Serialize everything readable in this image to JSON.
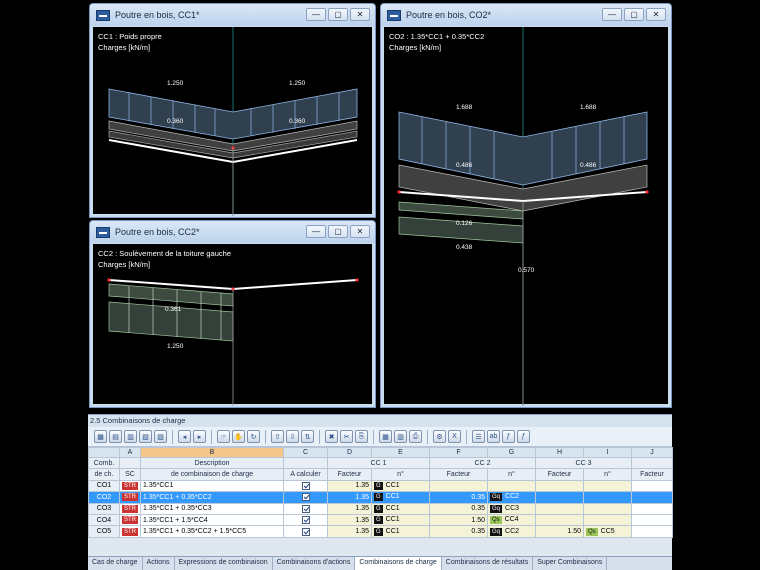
{
  "windows": {
    "cc1": {
      "title": "Poutre en bois, CC1*",
      "info_line1": "CC1 : Poids propre",
      "info_line2": "Charges [kN/m]",
      "labels": [
        "1.250",
        "1.250",
        "0.360",
        "0.360"
      ]
    },
    "cc2": {
      "title": "Poutre en bois, CC2*",
      "info_line1": "CC2 : Soulèvement de la toiture gauche",
      "info_line2": "Charges [kN/m]",
      "labels": [
        "0.361",
        "1.250"
      ]
    },
    "co2": {
      "title": "Poutre en bois, CO2*",
      "info_line1": "CO2 : 1.35*CC1 + 0.35*CC2",
      "info_line2": "Charges [kN/m]",
      "labels": [
        "1.688",
        "1.688",
        "0.486",
        "0.486",
        "0.126",
        "0.438",
        "0.570"
      ]
    },
    "controls": {
      "minimize": "—",
      "restore": "▢",
      "close": "✕"
    }
  },
  "panel": {
    "title": "2.5 Combinaisons de charge",
    "columns": [
      "A",
      "B",
      "C",
      "D",
      "E",
      "F",
      "G",
      "H",
      "I",
      "J"
    ],
    "headers": {
      "comb": "Comb.",
      "de_ch": "de ch.",
      "sc": "SC",
      "desc1": "Description",
      "desc2": "de combinaison de charge",
      "calc": "A calculer",
      "cc1": "CC 1",
      "cc2": "CC 2",
      "cc3": "CC 3",
      "facteur": "Facteur",
      "no": "n°"
    },
    "rows": [
      {
        "id": "CO1",
        "sc": "STR",
        "desc": "1.35*CC1",
        "f1": "1.35",
        "t1": "G",
        "c1": "CC1",
        "f2": "",
        "t2": "",
        "c2": "",
        "f3": "",
        "t3": "",
        "c3": ""
      },
      {
        "id": "CO2",
        "sc": "STR",
        "desc": "1.35*CC1 + 0.35*CC2",
        "f1": "1.35",
        "t1": "G",
        "c1": "CC1",
        "f2": "0.35",
        "t2": "Gq",
        "c2": "CC2",
        "f3": "",
        "t3": "",
        "c3": ""
      },
      {
        "id": "CO3",
        "sc": "STR",
        "desc": "1.35*CC1 + 0.35*CC3",
        "f1": "1.35",
        "t1": "G",
        "c1": "CC1",
        "f2": "0.35",
        "t2": "Gq",
        "c2": "CC3",
        "f3": "",
        "t3": "",
        "c3": ""
      },
      {
        "id": "CO4",
        "sc": "STR",
        "desc": "1.35*CC1 + 1.5*CC4",
        "f1": "1.35",
        "t1": "G",
        "c1": "CC1",
        "f2": "1.50",
        "t2": "Qs",
        "c2": "CC4",
        "f3": "",
        "t3": "",
        "c3": ""
      },
      {
        "id": "CO5",
        "sc": "STR",
        "desc": "1.35*CC1 + 0.35*CC2 + 1.5*CC5",
        "f1": "1.35",
        "t1": "G",
        "c1": "CC1",
        "f2": "0.35",
        "t2": "Gq",
        "c2": "CC2",
        "f3": "1.50",
        "t3": "Qs",
        "c3": "CC5"
      }
    ]
  },
  "tabs": [
    "Cas de charge",
    "Actions",
    "Expressions de combinaison",
    "Combinaisons d'actions",
    "Combinaisons de charge",
    "Combinaisons de résultats",
    "Super Combinaisons"
  ],
  "active_tab": "Combinaisons de charge",
  "colors": {
    "load": "#7ea8d8",
    "selection": "#3399ff",
    "str_badge": "#cc3333",
    "qs_badge": "#9bc45a"
  }
}
